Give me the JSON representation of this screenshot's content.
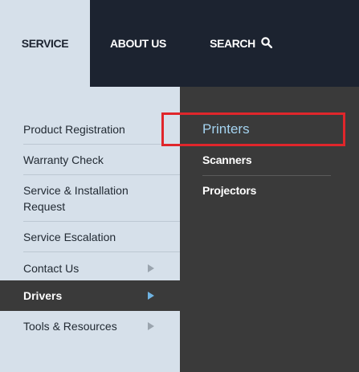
{
  "top_nav": {
    "service": "SERVICE",
    "about": "ABOUT US",
    "search": "SEARCH"
  },
  "left_menu": {
    "items": [
      {
        "label": "Product Registration",
        "has_arrow": false,
        "active": false
      },
      {
        "label": "Warranty Check",
        "has_arrow": false,
        "active": false
      },
      {
        "label": "Service & Installation",
        "label2": "Request",
        "has_arrow": false,
        "active": false
      },
      {
        "label": "Service Escalation",
        "has_arrow": false,
        "active": false
      },
      {
        "label": "Contact Us",
        "has_arrow": true,
        "active": false
      },
      {
        "label": "Drivers",
        "has_arrow": true,
        "active": true
      },
      {
        "label": "Tools & Resources",
        "has_arrow": true,
        "active": false
      }
    ]
  },
  "submenu": {
    "items": [
      {
        "label": "Printers",
        "highlighted": true
      },
      {
        "label": "Scanners",
        "highlighted": false
      },
      {
        "label": "Projectors",
        "highlighted": false
      }
    ]
  },
  "colors": {
    "topbar": "#1c2330",
    "menu_bg": "#d6e0ea",
    "submenu_bg": "#3a3a3a",
    "accent": "#6fb3e2",
    "highlight_border": "#e0262b"
  }
}
